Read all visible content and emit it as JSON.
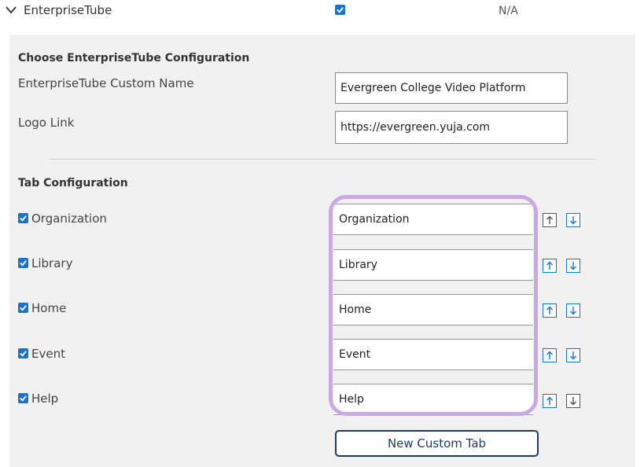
{
  "header": {
    "title": "EnterpriseTube",
    "enabled": true,
    "status": "N/A"
  },
  "config": {
    "section_title": "Choose EnterpriseTube Configuration",
    "custom_name_label": "EnterpriseTube Custom Name",
    "custom_name_value": "Evergreen College Video Platform",
    "logo_link_label": "Logo Link",
    "logo_link_value": "https://evergreen.yuja.com"
  },
  "tabs": {
    "section_title": "Tab Configuration",
    "items": [
      {
        "label": "Organization",
        "value": "Organization",
        "checked": true
      },
      {
        "label": "Library",
        "value": "Library",
        "checked": true
      },
      {
        "label": "Home",
        "value": "Home",
        "checked": true
      },
      {
        "label": "Event",
        "value": "Event",
        "checked": true
      },
      {
        "label": "Help",
        "value": "Help",
        "checked": true
      }
    ],
    "new_tab_button": "New Custom Tab"
  },
  "colors": {
    "accent": "#1a73c9",
    "highlight": "#c9a8e6",
    "button_border": "#1d3b5c",
    "panel_bg": "#f1f1f1"
  }
}
